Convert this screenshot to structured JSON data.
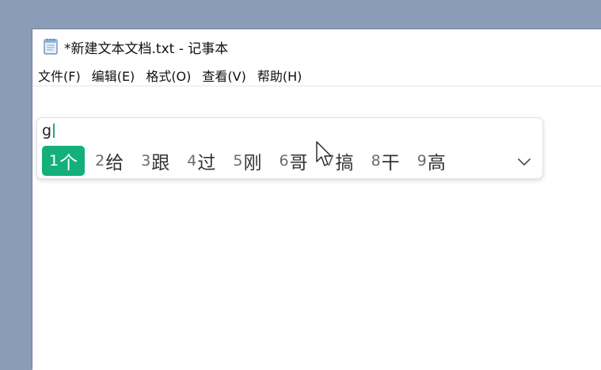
{
  "window": {
    "title": "*新建文本文档.txt - 记事本"
  },
  "menu": [
    {
      "label": "文件(F)"
    },
    {
      "label": "编辑(E)"
    },
    {
      "label": "格式(O)"
    },
    {
      "label": "查看(V)"
    },
    {
      "label": "帮助(H)"
    }
  ],
  "ime": {
    "composition": "g",
    "candidates": [
      {
        "num": "1",
        "word": "个",
        "selected": true
      },
      {
        "num": "2",
        "word": "给"
      },
      {
        "num": "3",
        "word": "跟"
      },
      {
        "num": "4",
        "word": "过"
      },
      {
        "num": "5",
        "word": "刚"
      },
      {
        "num": "6",
        "word": "哥"
      },
      {
        "num": "7",
        "word": "搞"
      },
      {
        "num": "8",
        "word": "干"
      },
      {
        "num": "9",
        "word": "高"
      }
    ],
    "expand_icon": "chevron-down-icon",
    "accent_color": "#13b07a"
  },
  "icons": {
    "app": "notepad-icon",
    "cursor": "mouse-pointer-icon"
  }
}
